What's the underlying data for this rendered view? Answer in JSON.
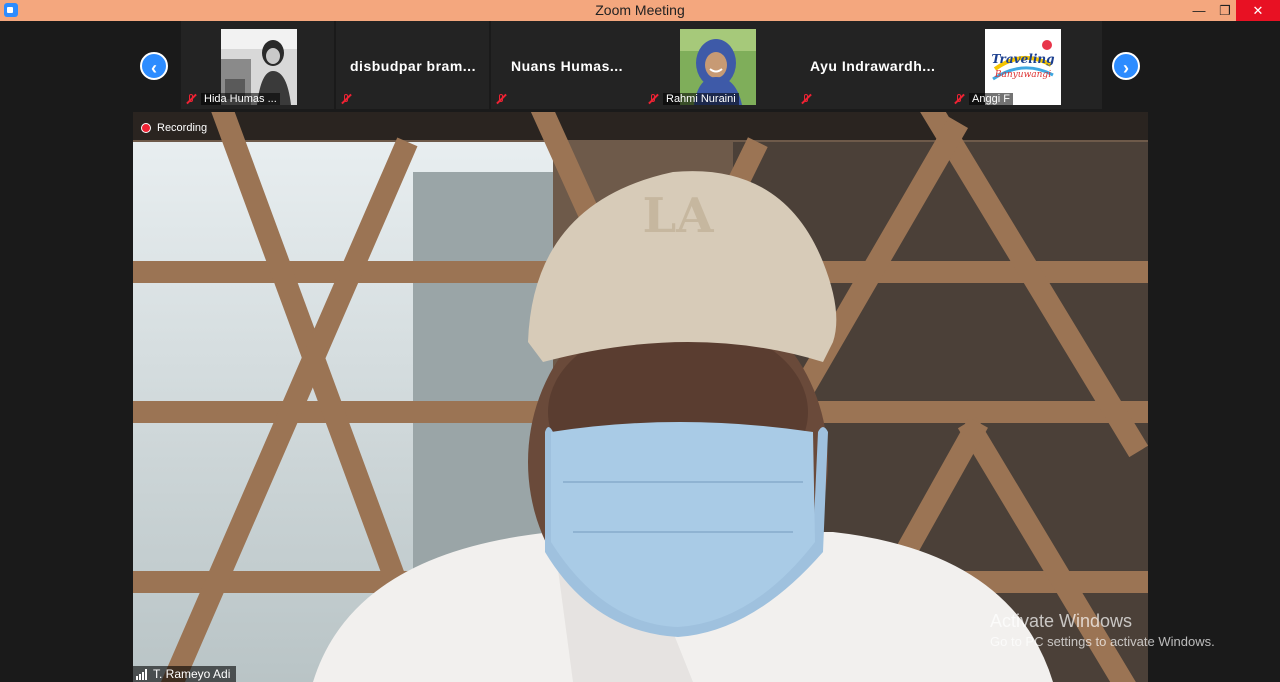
{
  "window": {
    "title": "Zoom Meeting",
    "minimize": "—",
    "restore": "❐",
    "close": "✕"
  },
  "nav": {
    "prev": "‹",
    "next": "›"
  },
  "participants": [
    {
      "label": "Hida Humas ...",
      "name": "",
      "thumb": "photo-bw"
    },
    {
      "label": "",
      "name": "disbudpar  bram...",
      "thumb": ""
    },
    {
      "label": "",
      "name": "Nuans  Humas...",
      "thumb": ""
    },
    {
      "label": "Rahmi Nuraini",
      "name": "",
      "thumb": "photo-hijab"
    },
    {
      "label": "",
      "name": "Ayu  Indrawardh...",
      "thumb": ""
    },
    {
      "label": "Anggi F",
      "name": "",
      "thumb": "logo-traveling"
    }
  ],
  "thumb_logo": {
    "line1": "Traveling",
    "line2": "Banyuwangi"
  },
  "recording": {
    "label": "Recording"
  },
  "active_speaker": {
    "name": "T. Rameyo Adi"
  },
  "watermark": {
    "line1": "Activate Windows",
    "line2": "Go to PC settings to activate Windows."
  },
  "colors": {
    "titlebar": "#f4a77e",
    "accent": "#2d8cff",
    "mute": "#ee2233",
    "close": "#e81123"
  }
}
